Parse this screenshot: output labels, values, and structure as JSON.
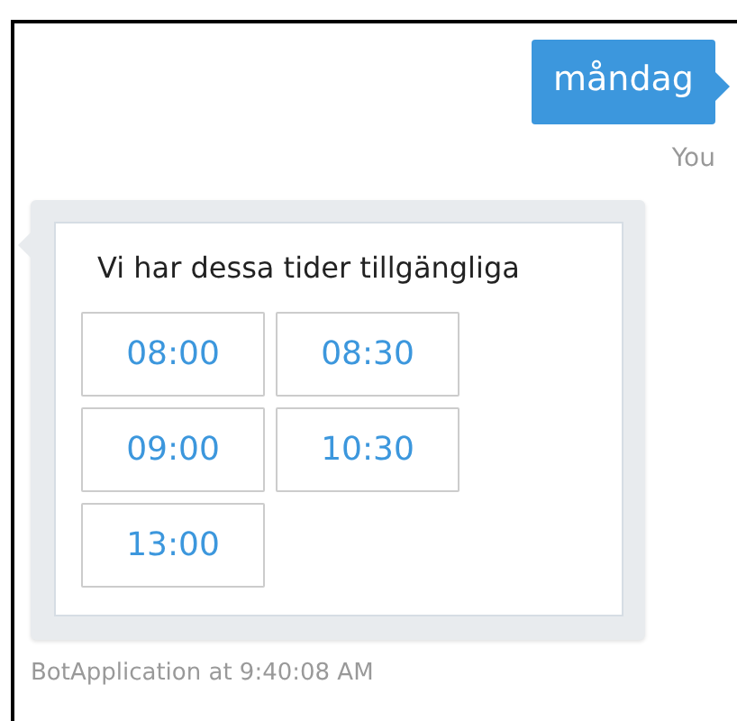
{
  "messages": [
    {
      "kind": "user",
      "text": "måndag",
      "sender": "You"
    },
    {
      "kind": "bot",
      "text": "Vi har dessa tider tillgängliga",
      "buttons": [
        "08:00",
        "08:30",
        "09:00",
        "10:30",
        "13:00"
      ],
      "sender": "BotApplication at 9:40:08 AM"
    }
  ]
}
